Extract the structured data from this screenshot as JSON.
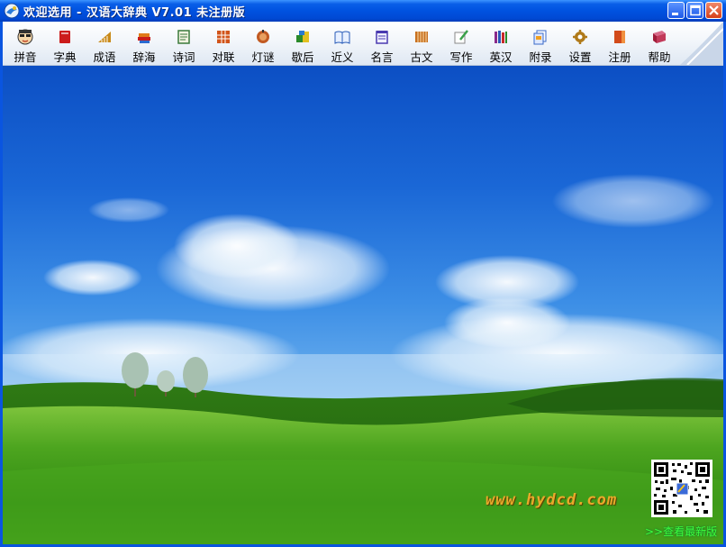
{
  "window": {
    "title": "欢迎选用 - 汉语大辞典 V7.01 未注册版",
    "controls": {
      "minimize": "minimize",
      "maximize": "maximize",
      "close": "close"
    }
  },
  "toolbar": {
    "items": [
      {
        "label": "拼音",
        "icon": "face-icon",
        "color": "#c04a2a"
      },
      {
        "label": "字典",
        "icon": "red-book-icon",
        "color": "#cc1c1c"
      },
      {
        "label": "成语",
        "icon": "ruler-icon",
        "color": "#c98a1a"
      },
      {
        "label": "辞海",
        "icon": "books-icon",
        "color": "#c81d1d"
      },
      {
        "label": "诗词",
        "icon": "scroll-icon",
        "color": "#3b7a3b"
      },
      {
        "label": "对联",
        "icon": "grid-icon",
        "color": "#d2541a"
      },
      {
        "label": "灯谜",
        "icon": "lantern-icon",
        "color": "#c25a22"
      },
      {
        "label": "歇后",
        "icon": "blocks-icon",
        "color": "#2a8a2a"
      },
      {
        "label": "近义",
        "icon": "open-book-icon",
        "color": "#2a5cb8"
      },
      {
        "label": "名言",
        "icon": "notepad-icon",
        "color": "#4a3ab0"
      },
      {
        "label": "古文",
        "icon": "bamboo-icon",
        "color": "#c87020"
      },
      {
        "label": "写作",
        "icon": "pen-paper-icon",
        "color": "#3aa04a"
      },
      {
        "label": "英汉",
        "icon": "bookshelf-icon",
        "color": "#8a2a8a"
      },
      {
        "label": "附录",
        "icon": "documents-icon",
        "color": "#3a6ac8"
      },
      {
        "label": "设置",
        "icon": "gear-icon",
        "color": "#b07a1a"
      },
      {
        "label": "注册",
        "icon": "register-book-icon",
        "color": "#d24a1a"
      },
      {
        "label": "帮助",
        "icon": "help-book-icon",
        "color": "#a01c3a"
      }
    ]
  },
  "main": {
    "website": "www.hydcd.com",
    "latest_version_link": ">>查看最新版"
  }
}
